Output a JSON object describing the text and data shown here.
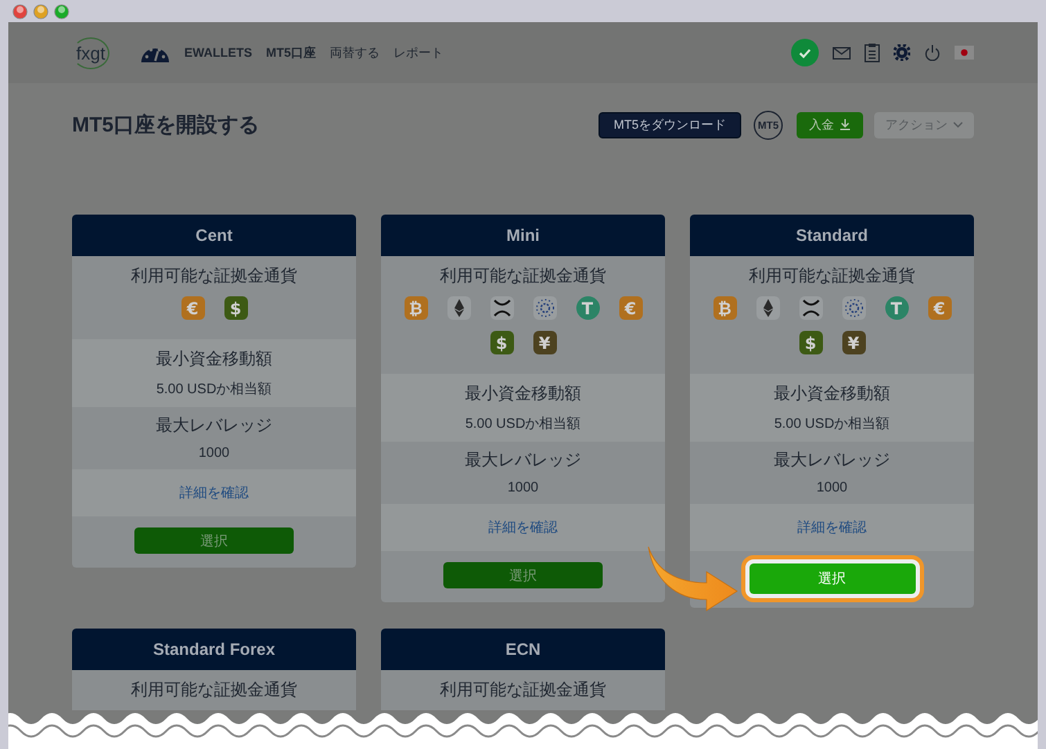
{
  "nav": {
    "logo": "fxgt",
    "items": [
      "EWALLETS",
      "MT5口座",
      "両替する",
      "レポート"
    ]
  },
  "title": "MT5口座を開設する",
  "actions": {
    "download": "MT5をダウンロード",
    "platform": "MT5",
    "deposit": "入金",
    "menu": "アクション"
  },
  "cards": [
    {
      "name": "Cent",
      "margin_label": "利用可能な証拠金通貨",
      "currencies": [
        {
          "kind": "coin",
          "symbol": "€",
          "color": "#b0701f"
        },
        {
          "kind": "coin",
          "symbol": "$",
          "color": "#3d5a14"
        }
      ],
      "min_label": "最小資金移動額",
      "min_value": "5.00 USDか相当額",
      "leverage_label": "最大レバレッジ",
      "leverage_value": "1000",
      "details": "詳細を確認",
      "select": "選択",
      "highlighted": false
    },
    {
      "name": "Mini",
      "margin_label": "利用可能な証拠金通貨",
      "currencies": [
        {
          "kind": "coin",
          "symbol": "₿",
          "color": "#b0701f"
        },
        {
          "kind": "eth"
        },
        {
          "kind": "xrp"
        },
        {
          "kind": "ada"
        },
        {
          "kind": "round",
          "symbol": "T",
          "color": "#2c8466"
        },
        {
          "kind": "coin",
          "symbol": "€",
          "color": "#b0701f"
        },
        {
          "kind": "coin",
          "symbol": "$",
          "color": "#3d5a14"
        },
        {
          "kind": "coin",
          "symbol": "¥",
          "color": "#4d4220"
        }
      ],
      "min_label": "最小資金移動額",
      "min_value": "5.00 USDか相当額",
      "leverage_label": "最大レバレッジ",
      "leverage_value": "1000",
      "details": "詳細を確認",
      "select": "選択",
      "highlighted": false
    },
    {
      "name": "Standard",
      "margin_label": "利用可能な証拠金通貨",
      "currencies": [
        {
          "kind": "coin",
          "symbol": "₿",
          "color": "#b0701f"
        },
        {
          "kind": "eth"
        },
        {
          "kind": "xrp"
        },
        {
          "kind": "ada"
        },
        {
          "kind": "round",
          "symbol": "T",
          "color": "#2c8466"
        },
        {
          "kind": "coin",
          "symbol": "€",
          "color": "#b0701f"
        },
        {
          "kind": "coin",
          "symbol": "$",
          "color": "#3d5a14"
        },
        {
          "kind": "coin",
          "symbol": "¥",
          "color": "#4d4220"
        }
      ],
      "min_label": "最小資金移動額",
      "min_value": "5.00 USDか相当額",
      "leverage_label": "最大レバレッジ",
      "leverage_value": "1000",
      "details": "詳細を確認",
      "select": "選択",
      "highlighted": true
    },
    {
      "name": "Standard Forex",
      "margin_label": "利用可能な証拠金通貨"
    },
    {
      "name": "ECN",
      "margin_label": "利用可能な証拠金通貨"
    }
  ]
}
